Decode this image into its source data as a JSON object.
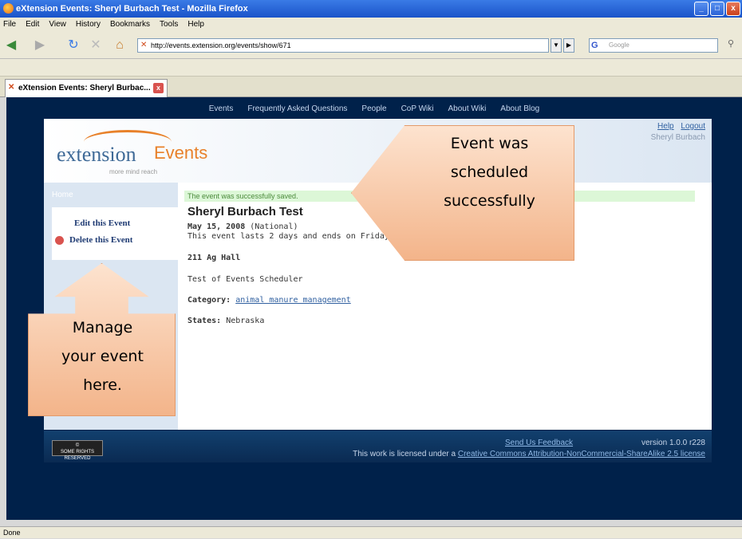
{
  "window": {
    "title": "eXtension Events: Sheryl Burbach Test - Mozilla Firefox"
  },
  "menu": [
    "File",
    "Edit",
    "View",
    "History",
    "Bookmarks",
    "Tools",
    "Help"
  ],
  "toolbar": {
    "url": "http://events.extension.org/events/show/671",
    "search_placeholder": "Google"
  },
  "tab": {
    "label": "eXtension Events: Sheryl Burbac..."
  },
  "site": {
    "nav": [
      "Events",
      "Frequently Asked Questions",
      "People",
      "CoP Wiki",
      "About Wiki",
      "About Blog"
    ],
    "logo": {
      "main": "extension",
      "suffix": "Events",
      "tagline": "more mind reach"
    },
    "header_links": {
      "help": "Help",
      "logout": "Logout",
      "user": "Sheryl Burbach"
    },
    "sidebar": {
      "home": "Home",
      "edit": "Edit this Event",
      "delete": "Delete this Event"
    },
    "event": {
      "flash": "The event was successfully saved.",
      "title": "Sheryl Burbach Test",
      "date": "May 15, 2008",
      "scope": "(National)",
      "duration": "This event lasts 2 days and ends on Friday May 16",
      "location": "211 Ag Hall",
      "description": "Test of Events Scheduler",
      "category_label": "Category:",
      "category": "animal manure management",
      "states_label": "States:",
      "states": "Nebraska"
    },
    "footer": {
      "cc": "SOME RIGHTS RESERVED",
      "feedback": "Send Us Feedback",
      "version": "version 1.0.0 r228",
      "license_prefix": "This work is licensed under a",
      "license_link": "Creative Commons Attribution-NonCommercial-ShareAlike 2.5 license"
    }
  },
  "annotations": {
    "callout_top": [
      "Event was",
      "scheduled",
      "successfully"
    ],
    "callout_left": [
      "Manage",
      "your event",
      "here."
    ]
  },
  "status": {
    "text": "Done"
  }
}
